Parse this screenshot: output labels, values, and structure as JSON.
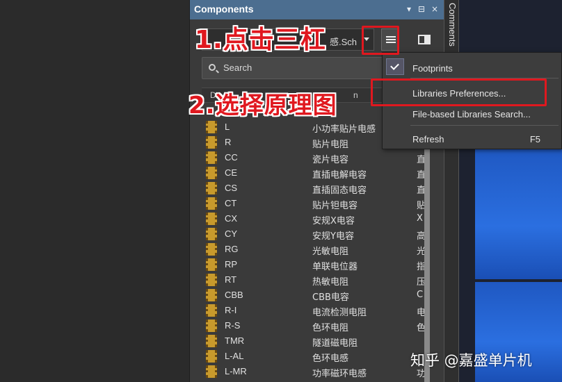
{
  "panel": {
    "title": "Components",
    "header_buttons": [
      "▾",
      "⊟",
      "×"
    ],
    "library_select": "感.Sch",
    "search": {
      "placeholder": "Search"
    },
    "columns": [
      "D",
      "n"
    ],
    "rows": [
      {
        "name": "L",
        "desc": "小功率贴片电感",
        "extra": "直"
      },
      {
        "name": "R",
        "desc": "贴片电阻",
        "extra": "贴"
      },
      {
        "name": "CC",
        "desc": "瓷片电容",
        "extra": "直"
      },
      {
        "name": "CE",
        "desc": "直插电解电容",
        "extra": "直"
      },
      {
        "name": "CS",
        "desc": "直插固态电容",
        "extra": "直"
      },
      {
        "name": "CT",
        "desc": "贴片钽电容",
        "extra": "贴"
      },
      {
        "name": "CX",
        "desc": "安规X电容",
        "extra": "X"
      },
      {
        "name": "CY",
        "desc": "安规Y电容",
        "extra": "高"
      },
      {
        "name": "RG",
        "desc": "光敏电阻",
        "extra": "光"
      },
      {
        "name": "RP",
        "desc": "单联电位器",
        "extra": "指"
      },
      {
        "name": "RT",
        "desc": "热敏电阻",
        "extra": "压"
      },
      {
        "name": "CBB",
        "desc": "CBB电容",
        "extra": "C"
      },
      {
        "name": "R-I",
        "desc": "电流检测电阻",
        "extra": "电"
      },
      {
        "name": "R-S",
        "desc": "色环电阻",
        "extra": "色"
      },
      {
        "name": "TMR",
        "desc": "隧道磁电阻",
        "extra": ""
      },
      {
        "name": "L-AL",
        "desc": "色环电感",
        "extra": ""
      },
      {
        "name": "L-MR",
        "desc": "功率磁环电感",
        "extra": "功"
      }
    ]
  },
  "side_tab": {
    "label": "Comments"
  },
  "menu": {
    "items": [
      {
        "label": "Footprints",
        "checked": true,
        "shortcut": ""
      },
      {
        "label": "Libraries Preferences...",
        "shortcut": ""
      },
      {
        "label": "File-based Libraries Search...",
        "shortcut": ""
      },
      {
        "label": "Refresh",
        "shortcut": "F5"
      }
    ]
  },
  "annotations": {
    "step1": "1.点击三杠",
    "step2": "2.选择原理图",
    "color": "#e0181f"
  },
  "watermark": "知乎 @嘉盛单片机",
  "colors": {
    "header": "#4c6e90",
    "panel_bg": "#3a3a3a",
    "icon": "#c89a2c"
  }
}
